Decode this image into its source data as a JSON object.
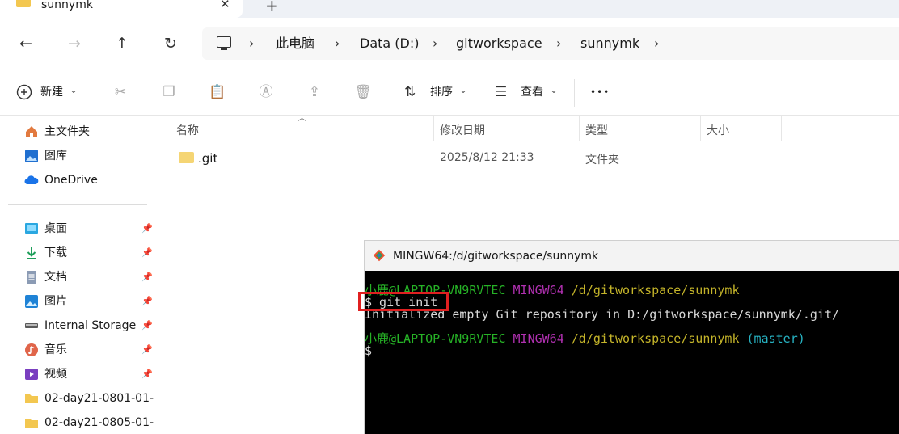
{
  "tab": {
    "title": "sunnymk",
    "close": "✕",
    "new": "+"
  },
  "nav": {
    "back": "←",
    "forward": "→",
    "up": "↑",
    "refresh": "↻"
  },
  "address": {
    "crumbs": [
      "此电脑",
      "Data (D:)",
      "gitworkspace",
      "sunnymk"
    ],
    "separator": "›"
  },
  "toolbar": {
    "new_label": "新建",
    "sort_label": "排序",
    "view_label": "查看",
    "more": "•••",
    "caret": "⌄"
  },
  "sidebar": {
    "quick": [
      "主文件夹",
      "图库",
      "OneDrive"
    ],
    "pinned": [
      "桌面",
      "下载",
      "文档",
      "图片",
      "Internal Storage",
      "音乐",
      "视频"
    ],
    "folders": [
      "02-day21-0801-01-",
      "02-day21-0805-01-"
    ]
  },
  "columns": {
    "name": "名称",
    "modified": "修改日期",
    "type": "类型",
    "size": "大小"
  },
  "files": [
    {
      "name": ".git",
      "modified": "2025/8/12 21:33",
      "type": "文件夹",
      "size": ""
    }
  ],
  "terminal": {
    "title": "MINGW64:/d/gitworkspace/sunnymk",
    "lines": [
      {
        "user": "小鹿@LAPTOP-VN9RVTEC",
        "env": "MINGW64",
        "path": "/d/gitworkspace/sunnymk",
        "branch": ""
      },
      {
        "cmd": "$ git init"
      },
      {
        "output": "Initialized empty Git repository in D:/gitworkspace/sunnymk/.git/"
      },
      {
        "user": "小鹿@LAPTOP-VN9RVTEC",
        "env": "MINGW64",
        "path": "/d/gitworkspace/sunnymk",
        "branch": "(master)"
      },
      {
        "cmd": "$"
      }
    ]
  },
  "colors": {
    "accent": "#e02020",
    "folder": "#f3c750",
    "prompt_user": "#26b226",
    "prompt_env": "#b030b0",
    "prompt_path": "#c5b52a",
    "prompt_branch": "#27b3c3"
  }
}
